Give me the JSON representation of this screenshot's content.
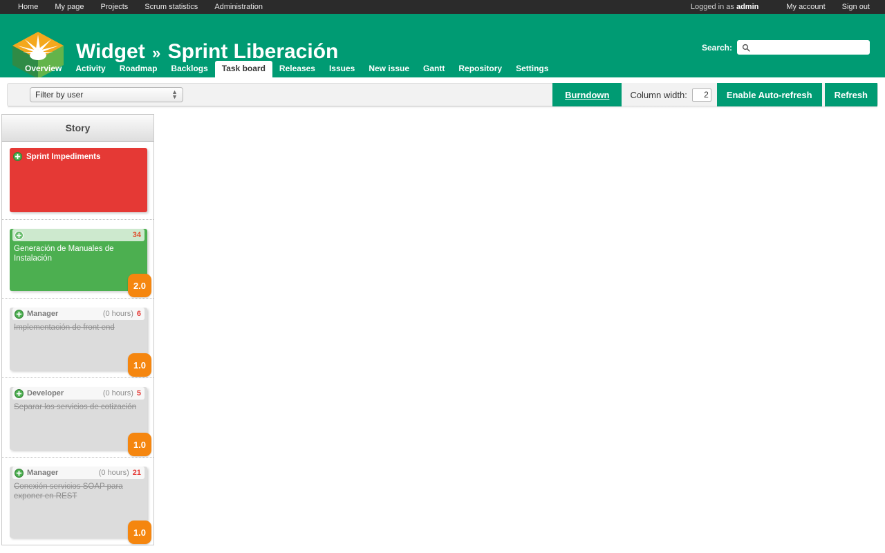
{
  "top_menu": {
    "links": [
      "Home",
      "My page",
      "Projects",
      "Scrum statistics",
      "Administration"
    ],
    "logged_in_prefix": "Logged in as ",
    "logged_in_user": "admin",
    "account_link": "My account",
    "signout_link": "Sign out"
  },
  "header": {
    "project": "Widget",
    "separator": "»",
    "sprint": "Sprint Liberación",
    "search_label": "Search:",
    "search_value": "",
    "search_placeholder": "",
    "search_icon": "search-icon",
    "logo_icon": "cube-logo-icon",
    "colors": {
      "header_green": "#009b73",
      "logo_top": "#f4a81d",
      "logo_left": "#2e8b45",
      "logo_right": "#62b44a"
    }
  },
  "tabs": [
    {
      "label": "Overview",
      "selected": false
    },
    {
      "label": "Activity",
      "selected": false
    },
    {
      "label": "Roadmap",
      "selected": false
    },
    {
      "label": "Backlogs",
      "selected": false
    },
    {
      "label": "Task board",
      "selected": true
    },
    {
      "label": "Releases",
      "selected": false
    },
    {
      "label": "Issues",
      "selected": false
    },
    {
      "label": "New issue",
      "selected": false
    },
    {
      "label": "Gantt",
      "selected": false
    },
    {
      "label": "Repository",
      "selected": false
    },
    {
      "label": "Settings",
      "selected": false
    }
  ],
  "toolbar": {
    "user_filter_selected": "Filter by user",
    "user_filter_options": [
      "Filter by user"
    ],
    "burndown_label": "Burndown",
    "column_width_label": "Column width:",
    "column_width_value": "2",
    "autorefresh_label": "Enable Auto-refresh",
    "refresh_label": "Refresh",
    "button_color": "#009b73"
  },
  "board": {
    "columns": [
      {
        "label": "Story"
      }
    ],
    "cards": [
      {
        "kind": "impediment",
        "title": "Sprint Impediments",
        "icon": "add-circle-icon",
        "color": "#e53935"
      },
      {
        "kind": "story",
        "icon": "add-circle-icon",
        "id": "34",
        "title": "Generación de Manuales de Instalación",
        "points": "2.0",
        "color": "#4caf50"
      },
      {
        "kind": "task",
        "icon": "add-circle-icon",
        "role": "Manager",
        "hours": "(0 hours)",
        "id": "6",
        "title": "Implementación de front end",
        "points": "1.0",
        "color": "#dcdcdc",
        "done": true
      },
      {
        "kind": "task",
        "icon": "add-circle-icon",
        "role": "Developer",
        "hours": "(0 hours)",
        "id": "5",
        "title": "Separar los servicios de cotización",
        "points": "1.0",
        "color": "#dcdcdc",
        "done": true
      },
      {
        "kind": "task-tall",
        "icon": "add-circle-icon",
        "role": "Manager",
        "hours": "(0 hours)",
        "id": "21",
        "title": "Conexión servicios SOAP para exponer en REST",
        "points": "1.0",
        "color": "#dcdcdc",
        "done": true
      }
    ]
  }
}
